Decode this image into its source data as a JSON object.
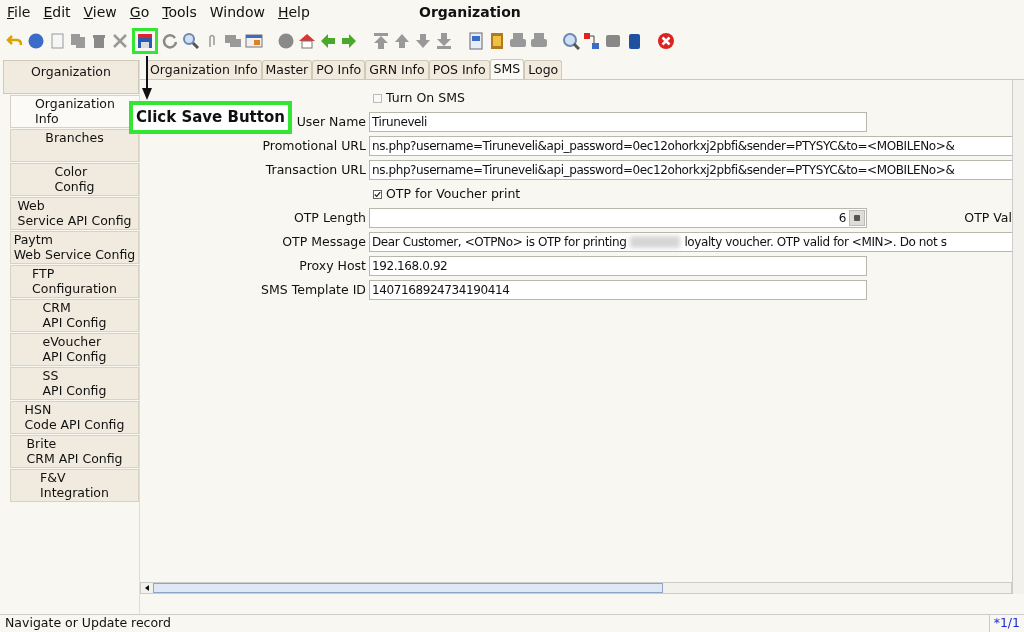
{
  "menu": [
    {
      "label": "File",
      "mnemonic": true
    },
    {
      "label": "Edit",
      "mnemonic": true
    },
    {
      "label": "View",
      "mnemonic": true
    },
    {
      "label": "Go",
      "mnemonic": true
    },
    {
      "label": "Tools",
      "mnemonic": true
    },
    {
      "label": "Window",
      "mnemonic": false
    },
    {
      "label": "Help",
      "mnemonic": true
    }
  ],
  "window": {
    "title": "Organization"
  },
  "annotation": {
    "text": "Click Save Button"
  },
  "sidebar": {
    "header": "Organization",
    "items": [
      {
        "lines": [
          "Organization",
          "Info"
        ],
        "selected": true
      },
      {
        "lines": [
          "Branches"
        ],
        "selected": false
      },
      {
        "lines": [
          "Color",
          "Config"
        ],
        "selected": false
      },
      {
        "lines": [
          "Web",
          "Service API Config"
        ],
        "selected": false
      },
      {
        "lines": [
          "Paytm",
          "Web Service Config"
        ],
        "selected": false
      },
      {
        "lines": [
          "FTP",
          "Configuration"
        ],
        "selected": false
      },
      {
        "lines": [
          "CRM",
          "API Config"
        ],
        "selected": false
      },
      {
        "lines": [
          "eVoucher",
          "API Config"
        ],
        "selected": false
      },
      {
        "lines": [
          "SS",
          "API Config"
        ],
        "selected": false
      },
      {
        "lines": [
          "HSN",
          "Code API Config"
        ],
        "selected": false
      },
      {
        "lines": [
          "Brite",
          "CRM API Config"
        ],
        "selected": false
      },
      {
        "lines": [
          "F&V",
          "Integration"
        ],
        "selected": false
      }
    ]
  },
  "tabs": [
    {
      "label": "Organization Info",
      "selected": false
    },
    {
      "label": "Master",
      "selected": false
    },
    {
      "label": "PO Info",
      "selected": false
    },
    {
      "label": "GRN Info",
      "selected": false
    },
    {
      "label": "POS Info",
      "selected": false
    },
    {
      "label": "SMS",
      "selected": true
    },
    {
      "label": "Logo",
      "selected": false
    }
  ],
  "form": [
    {
      "kind": "checkbox",
      "label": "Turn On SMS",
      "checked": false
    },
    {
      "kind": "text",
      "label": "User Name",
      "value": "Tiruneveli"
    },
    {
      "kind": "wide",
      "label": "Promotional URL",
      "value": "ns.php?username=Tiruneveli&api_password=0ec12ohorkxj2pbfi&sender=PTYSYC&to=<MOBILENo>&"
    },
    {
      "kind": "wide",
      "label": "Transaction URL",
      "value": "ns.php?username=Tiruneveli&api_password=0ec12ohorkxj2pbfi&sender=PTYSYC&to=<MOBILENo>&"
    },
    {
      "kind": "checkbox",
      "label": "OTP for Voucher print",
      "checked": true
    },
    {
      "kind": "number",
      "label": "OTP Length",
      "value": "6",
      "side_label": "OTP Val"
    },
    {
      "kind": "message",
      "label": "OTP Message",
      "value": "Dear Customer, <OTPNo> is OTP for printing",
      "value_after": "loyalty voucher. OTP valid for <MIN>. Do not s"
    },
    {
      "kind": "text",
      "label": "Proxy Host",
      "value": "192.168.0.92"
    },
    {
      "kind": "text",
      "label": "SMS Template ID",
      "value": "1407168924734190414"
    }
  ],
  "status_bar": {
    "message": "Navigate or Update record",
    "record": "*1/1"
  }
}
